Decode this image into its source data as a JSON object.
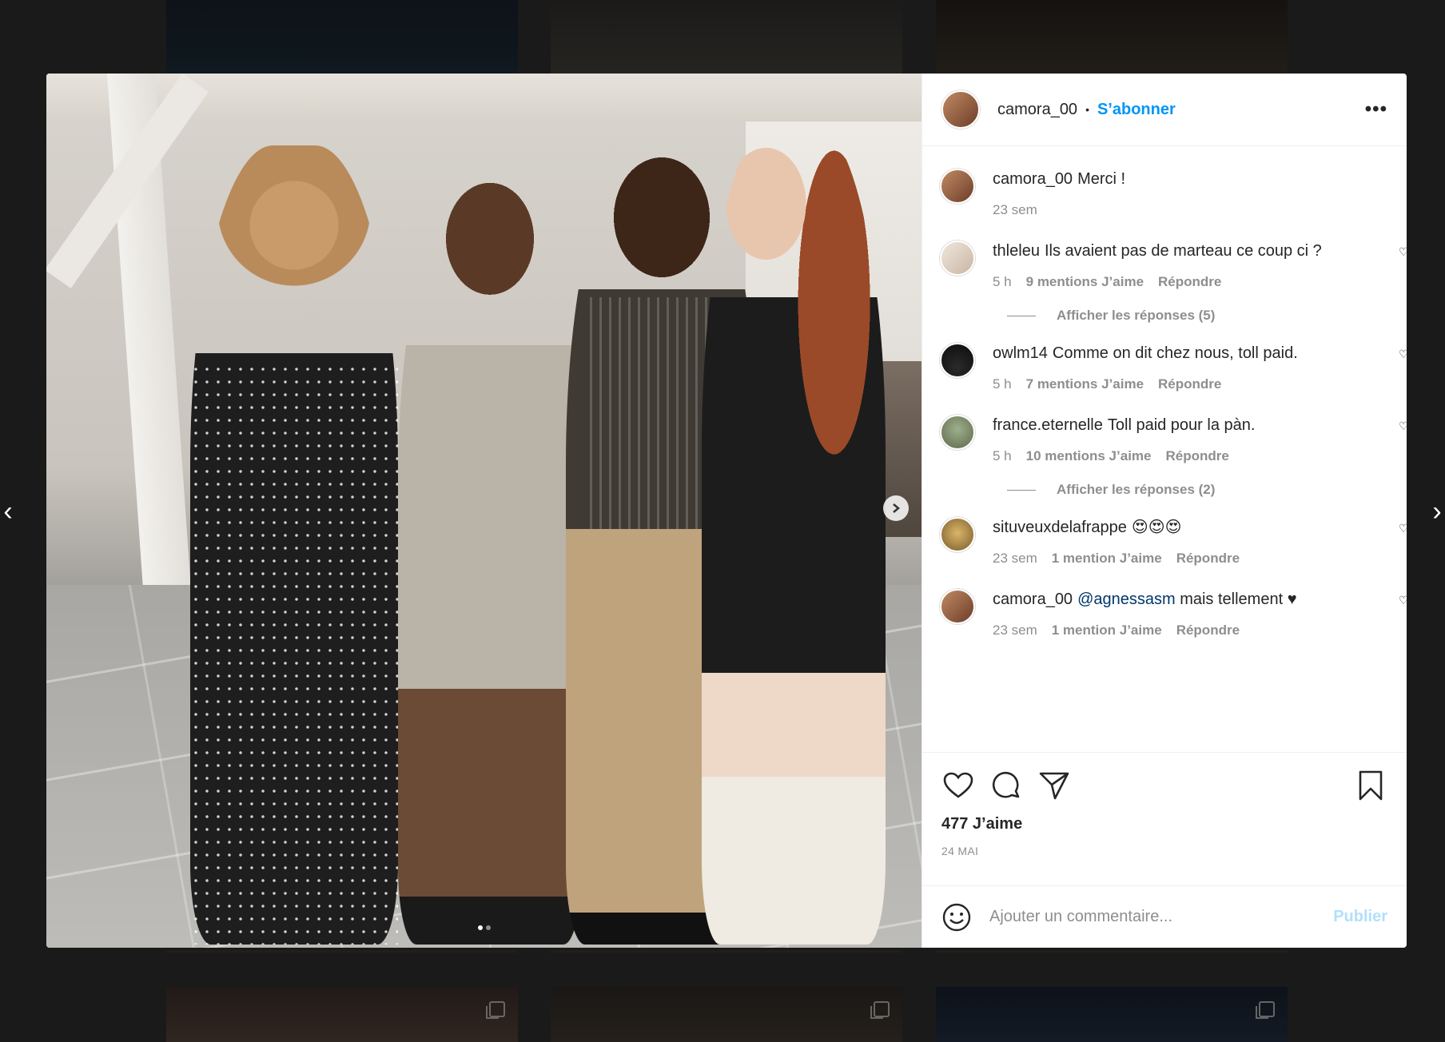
{
  "post": {
    "username": "camora_00",
    "follow_label": "S’abonner",
    "more_label": "•••",
    "likes": "477 J’aime",
    "date": "24 MAI",
    "carousel": {
      "count": 2,
      "active": 0
    }
  },
  "comments": [
    {
      "user": "camora_00",
      "text": "Merci !",
      "time": "23 sem",
      "likes": "",
      "reply": "",
      "avatar": "#b7785a"
    },
    {
      "user": "thleleu",
      "text": "Ils avaient pas de marteau ce coup ci ?",
      "time": "5 h",
      "likes": "9 mentions J’aime",
      "reply": "Répondre",
      "replies": "Afficher les réponses (5)",
      "avatar": "#e6d8cc"
    },
    {
      "user": "owlm14",
      "text": "Comme on dit chez nous, toll paid.",
      "time": "5 h",
      "likes": "7 mentions J’aime",
      "reply": "Répondre",
      "avatar": "#151515"
    },
    {
      "user": "france.eternelle",
      "text": "Toll paid pour la pàn.",
      "time": "5 h",
      "likes": "10 mentions J’aime",
      "reply": "Répondre",
      "replies": "Afficher les réponses (2)",
      "avatar": "#7d8a6a"
    },
    {
      "user": "situveuxdelafrappe",
      "text": "😍😍😍",
      "time": "23 sem",
      "likes": "1 mention J’aime",
      "reply": "Répondre",
      "avatar": "#b59a5a"
    },
    {
      "user": "camora_00",
      "mention": "@agnessasm",
      "text": "mais tellement ♥",
      "time": "23 sem",
      "likes": "1 mention J’aime",
      "reply": "Répondre",
      "avatar": "#b7785a"
    }
  ],
  "composer": {
    "placeholder": "Ajouter un commentaire...",
    "publish_label": "Publier"
  },
  "icons": {
    "like": "heart-icon",
    "comment": "comment-icon",
    "share": "paper-plane-icon",
    "save": "bookmark-icon",
    "emoji": "emoji-icon",
    "prev": "chevron-left-icon",
    "next": "chevron-right-icon"
  },
  "colors": {
    "accent": "#0095f6",
    "publish_disabled": "#b2dffc",
    "text": "#262626",
    "muted": "#8e8e8e",
    "mention": "#00376b"
  }
}
